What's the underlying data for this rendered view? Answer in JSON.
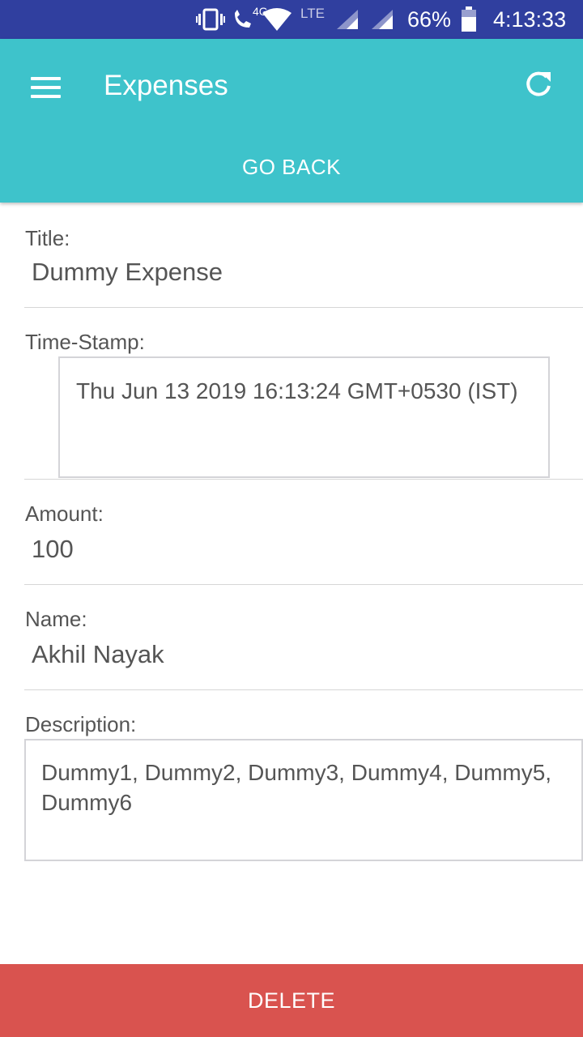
{
  "status_bar": {
    "network_type": "4G",
    "lte": "LTE",
    "battery": "66%",
    "time": "4:13:33"
  },
  "app_bar": {
    "title": "Expenses",
    "go_back_label": "GO BACK"
  },
  "fields": {
    "title_label": "Title:",
    "title_value": "Dummy Expense",
    "timestamp_label": "Time-Stamp:",
    "timestamp_value": "Thu Jun 13 2019 16:13:24 GMT+0530 (IST)",
    "amount_label": "Amount:",
    "amount_value": "100",
    "name_label": "Name:",
    "name_value": "Akhil Nayak",
    "description_label": "Description:",
    "description_value": "Dummy1, Dummy2, Dummy3, Dummy4, Dummy5, Dummy6"
  },
  "actions": {
    "delete_label": "DELETE"
  },
  "colors": {
    "status_bar": "#303f9f",
    "app_bar": "#3ec3cb",
    "delete": "#d9534f"
  },
  "icons": [
    "vibrate-icon",
    "wifi-calling-icon",
    "wifi-icon",
    "signal-icon",
    "battery-icon",
    "menu-icon",
    "refresh-icon"
  ]
}
